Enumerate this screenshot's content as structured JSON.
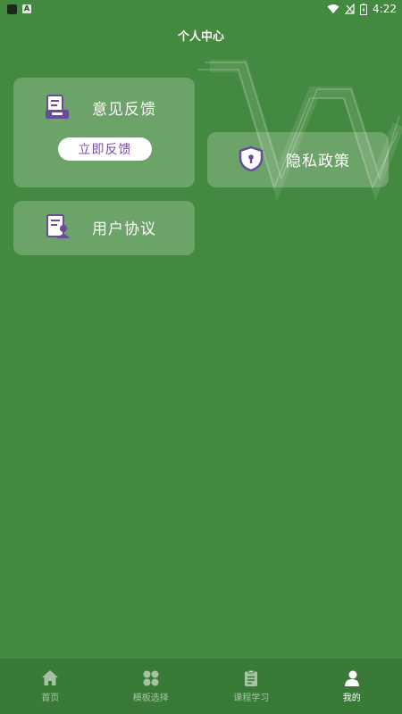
{
  "status_bar": {
    "time": "4:22",
    "notification": "A"
  },
  "header": {
    "title": "个人中心"
  },
  "cards": {
    "feedback": {
      "label": "意见反馈",
      "button_label": "立即反馈",
      "icon": "feedback-icon"
    },
    "agreement": {
      "label": "用户协议",
      "icon": "user-agreement-icon"
    },
    "privacy": {
      "label": "隐私政策",
      "icon": "shield-icon"
    }
  },
  "tabs": [
    {
      "label": "首页",
      "icon": "home-icon",
      "active": false
    },
    {
      "label": "模板选择",
      "icon": "grid-icon",
      "active": false
    },
    {
      "label": "课程学习",
      "icon": "clipboard-icon",
      "active": false
    },
    {
      "label": "我的",
      "icon": "user-icon",
      "active": true
    }
  ],
  "colors": {
    "background": "#43893f",
    "tab_bar": "#3a7a37",
    "accent_purple": "#7b4aa6",
    "icon_purple": "#6a4a9a"
  }
}
